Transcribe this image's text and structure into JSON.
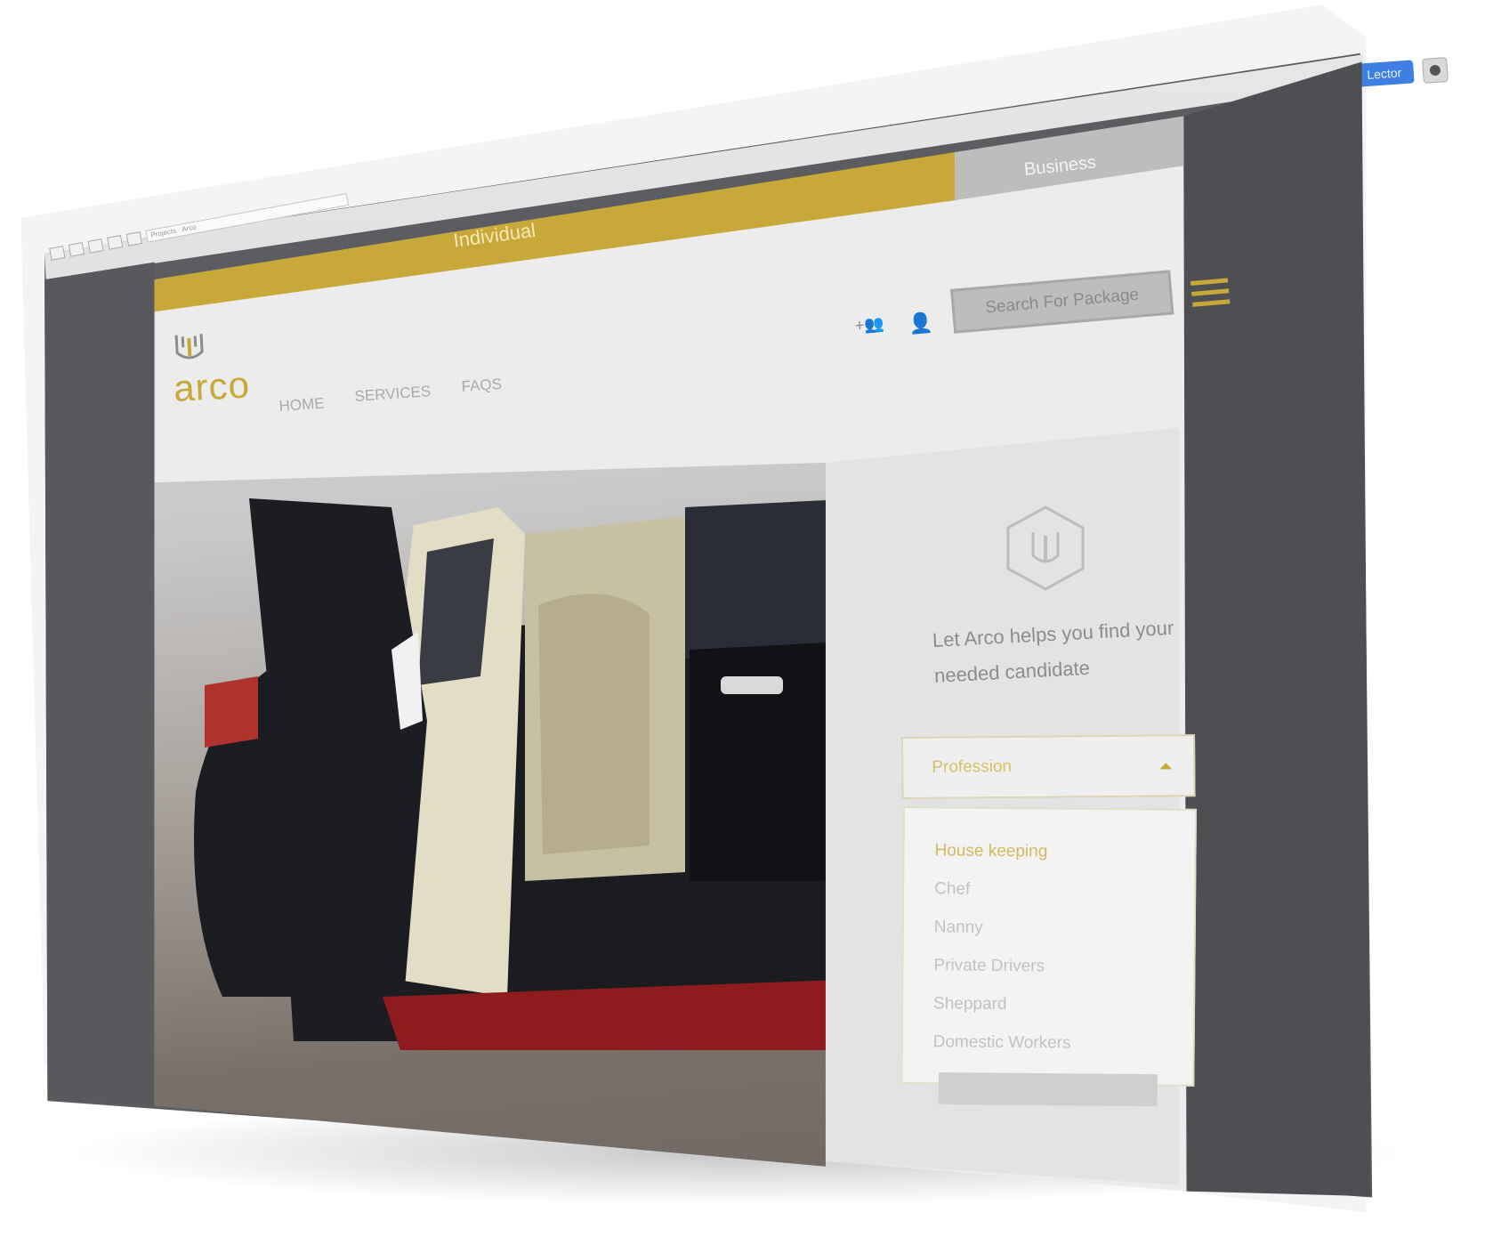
{
  "browser": {
    "address_text": "Projects · Arco",
    "reader_label": "Lector"
  },
  "tabs": {
    "individual": "Individual",
    "business": "Business"
  },
  "header": {
    "search_label": "Search For Package",
    "logo_word": "arco",
    "logo_tagline": "",
    "nav": [
      "HOME",
      "SERVICES",
      "FAQS"
    ]
  },
  "panel": {
    "help_text": "Let Arco helps you find your needed candidate",
    "profession_label": "Profession",
    "options": [
      "House keeping",
      "Chef",
      "Nanny",
      "Private Drivers",
      "Sheppard",
      "Domestic Workers"
    ],
    "selected_option": "House keeping"
  },
  "colors": {
    "gold": "#c8a839",
    "grey_tab": "#bdbdbd",
    "side_bg": "#58595d"
  },
  "icons": {
    "add_user": "add-user-icon",
    "user": "user-icon",
    "menu": "hamburger-menu-icon",
    "reload": "reload-icon",
    "brand_hex": "arco-hex-logo-icon"
  }
}
